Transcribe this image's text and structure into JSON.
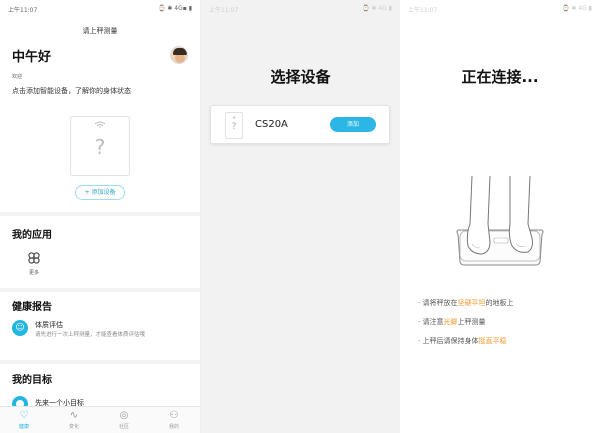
{
  "screen1": {
    "status": {
      "time": "上午11:07",
      "icons": "⌚ ✱ 4G▪ ▮"
    },
    "title": "请上秤测量",
    "greeting": "中午好",
    "greeting_sub": "欢迎",
    "tip": "点击添加智能设备，了解你的身体状态",
    "add_device_label": "+ 添加设备",
    "my_apps": {
      "title": "我的应用",
      "more_label": "更多"
    },
    "health_report": {
      "title": "健康报告",
      "item_title": "体质评估",
      "item_desc": "请先进行一次上秤测量，才能查看体质评估哦"
    },
    "my_goal": {
      "title": "我的目标",
      "item_title": "先来一个小目标"
    },
    "tabs": [
      {
        "label": "健康",
        "icon": "heart-icon",
        "active": true
      },
      {
        "label": "变化",
        "icon": "wave-chart-icon",
        "active": false
      },
      {
        "label": "社区",
        "icon": "community-icon",
        "active": false
      },
      {
        "label": "我的",
        "icon": "person-icon",
        "active": false
      }
    ]
  },
  "screen2": {
    "status": {
      "time": "上午11:07",
      "icons": "⌚ ✱ 4G ▮"
    },
    "title": "选择设备",
    "device": {
      "name": "CS20A",
      "add_label": "添加"
    }
  },
  "screen3": {
    "status": {
      "time": "上午11:07",
      "icons": "⌚ ✱ 4G ▮"
    },
    "title": "正在连接...",
    "scale_icon": "smart-scale-feet-icon",
    "instructions": [
      {
        "prefix": "· 请将秤放在",
        "highlight": "坚硬平坦",
        "suffix": "的地板上"
      },
      {
        "prefix": "· 请注意",
        "highlight": "光脚",
        "suffix": "上秤测量"
      },
      {
        "prefix": "· 上秤后请保持身体",
        "highlight": "挺直平稳",
        "suffix": ""
      }
    ]
  },
  "colors": {
    "accent": "#21b5e0",
    "highlight": "#f29a2e",
    "background_gray": "#f2f2f2"
  }
}
